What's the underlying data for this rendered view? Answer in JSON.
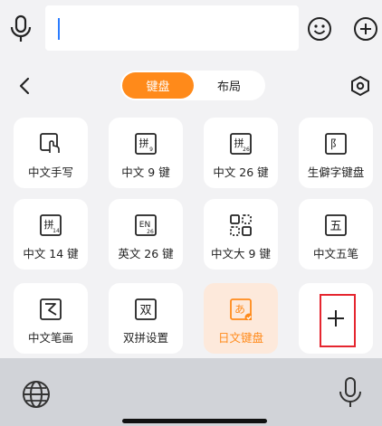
{
  "segments": {
    "keyboard": "键盘",
    "layout": "布局"
  },
  "colors": {
    "accent": "#ff8a1a",
    "highlight": "#e5262f"
  },
  "cards": [
    {
      "label": "中文手写",
      "icon": "handwriting-icon"
    },
    {
      "label": "中文 9 键",
      "icon": "pinyin-9-icon",
      "glyph": "拼",
      "sub": "9"
    },
    {
      "label": "中文 26 键",
      "icon": "pinyin-26-icon",
      "glyph": "拼",
      "sub": "26"
    },
    {
      "label": "生僻字键盘",
      "icon": "rare-char-icon",
      "glyph": "阝"
    },
    {
      "label": "中文 14 键",
      "icon": "pinyin-14-icon",
      "glyph": "拼",
      "sub": "14"
    },
    {
      "label": "英文 26 键",
      "icon": "english-26-icon",
      "glyph": "EN",
      "sub": "26"
    },
    {
      "label": "中文大 9 键",
      "icon": "large-9-grid-icon"
    },
    {
      "label": "中文五笔",
      "icon": "wubi-icon",
      "glyph": "五"
    },
    {
      "label": "中文笔画",
      "icon": "stroke-icon"
    },
    {
      "label": "双拼设置",
      "icon": "shuangpin-icon",
      "glyph": "双"
    },
    {
      "label": "日文键盘",
      "icon": "japanese-icon",
      "glyph": "あ",
      "selected": true
    }
  ]
}
